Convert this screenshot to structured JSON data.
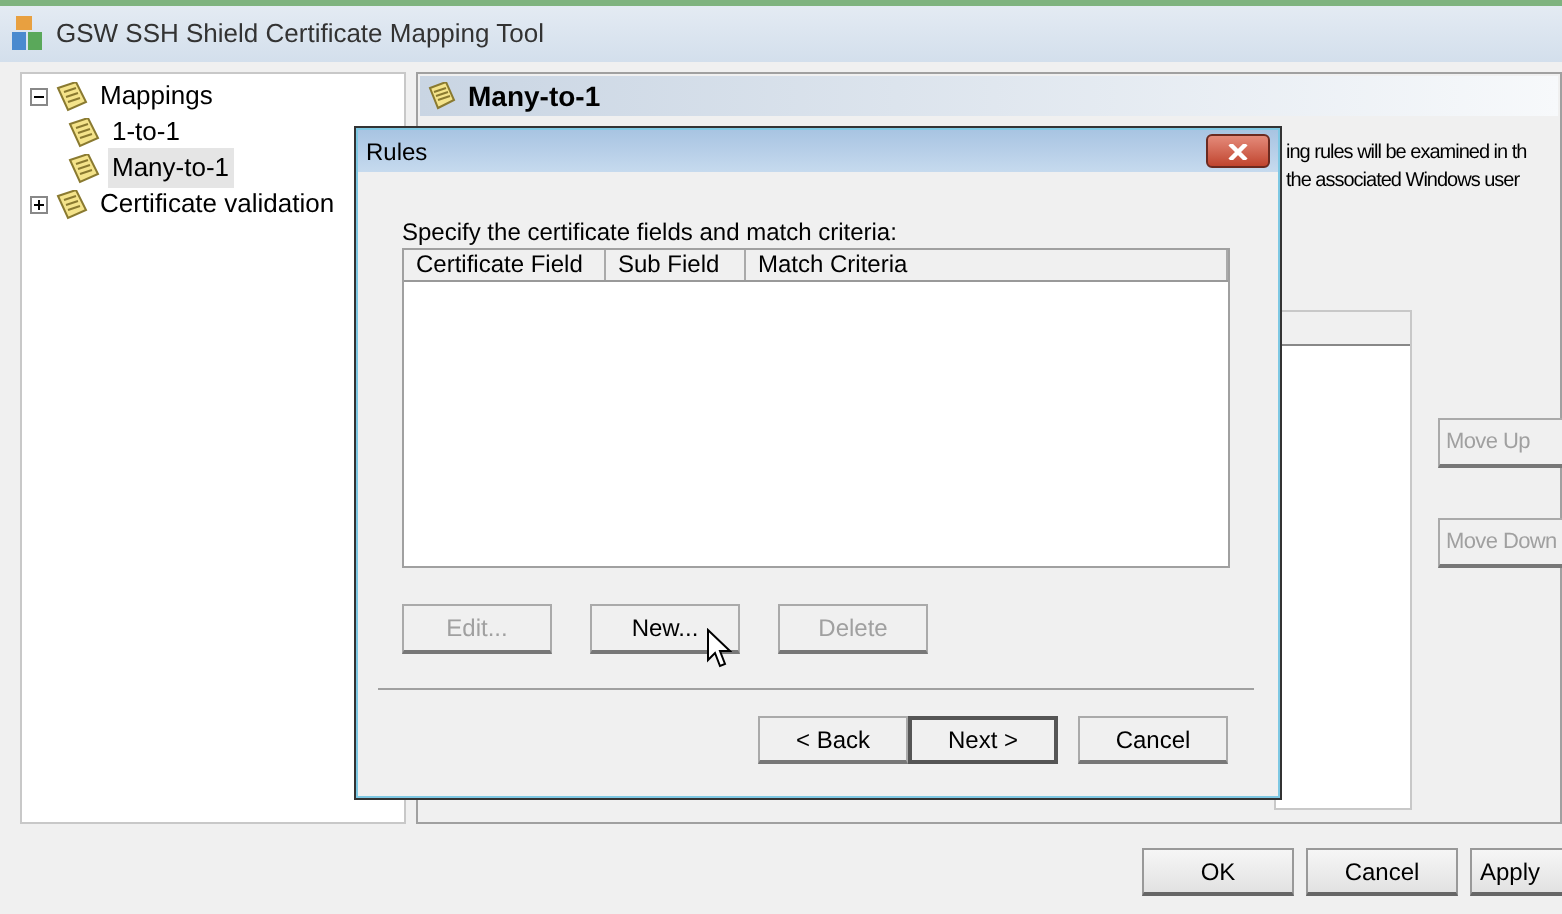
{
  "window": {
    "title": "GSW SSH Shield Certificate Mapping Tool"
  },
  "tree": [
    {
      "label": "Mappings",
      "expanded": true,
      "selected": false,
      "children": [
        {
          "label": "1-to-1",
          "selected": false
        },
        {
          "label": "Many-to-1",
          "selected": true
        }
      ]
    },
    {
      "label": "Certificate validation",
      "expanded": false,
      "selected": false
    }
  ],
  "panel": {
    "title": "Many-to-1",
    "description_lines": [
      "ing rules will be examined in th",
      "the associated Windows user"
    ],
    "side_buttons": [
      {
        "label": "Move Up",
        "disabled": true
      },
      {
        "label": "Move Down",
        "disabled": true
      }
    ]
  },
  "dialog": {
    "title": "Rules",
    "instruction": "Specify the certificate fields and match criteria:",
    "columns": [
      "Certificate Field",
      "Sub Field",
      "Match Criteria"
    ],
    "list_buttons": [
      {
        "label": "Edit...",
        "disabled": true
      },
      {
        "label": "New...",
        "disabled": false
      },
      {
        "label": "Delete",
        "disabled": true
      }
    ],
    "nav_buttons": [
      {
        "label": "< Back",
        "default": false
      },
      {
        "label": "Next >",
        "default": true
      },
      {
        "label": "Cancel",
        "default": false
      }
    ]
  },
  "buttons": [
    {
      "label": "OK"
    },
    {
      "label": "Cancel"
    },
    {
      "label": "Apply"
    }
  ]
}
